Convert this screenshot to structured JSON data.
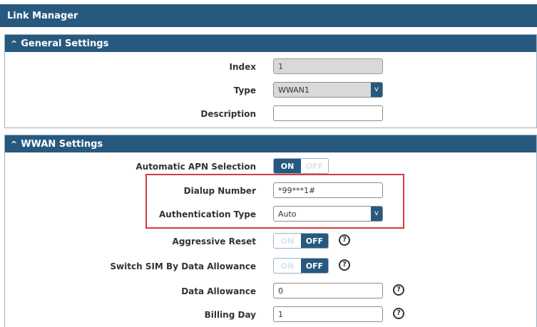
{
  "title": "Link Manager",
  "general": {
    "header": "General Settings",
    "index_label": "Index",
    "index_value": "1",
    "type_label": "Type",
    "type_value": "WWAN1",
    "description_label": "Description",
    "description_value": ""
  },
  "wwan": {
    "header": "WWAN Settings",
    "auto_apn_label": "Automatic APN Selection",
    "auto_apn_on": "ON",
    "auto_apn_off": "OFF",
    "dialup_label": "Dialup Number",
    "dialup_value": "*99***1#",
    "auth_label": "Authentication Type",
    "auth_value": "Auto",
    "aggressive_label": "Aggressive Reset",
    "aggressive_on": "ON",
    "aggressive_off": "OFF",
    "switch_sim_label": "Switch SIM By Data Allowance",
    "switch_sim_on": "ON",
    "switch_sim_off": "OFF",
    "data_allowance_label": "Data Allowance",
    "data_allowance_value": "0",
    "billing_label": "Billing Day",
    "billing_value": "1"
  },
  "icons": {
    "caret": "^",
    "dropdown": "v",
    "help": "?"
  },
  "colors": {
    "header": "#27597f",
    "highlight": "#d63a3a"
  }
}
